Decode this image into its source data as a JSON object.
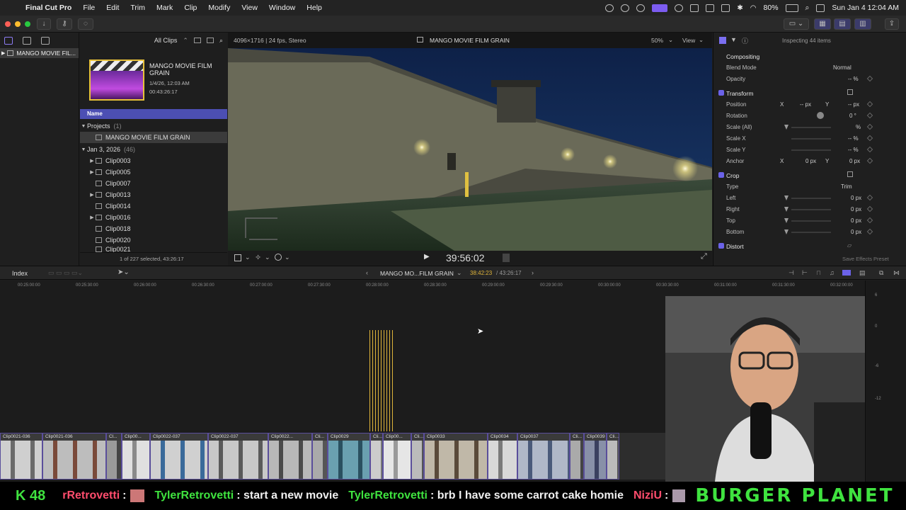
{
  "menubar": {
    "app_name": "Final Cut Pro",
    "menus": [
      "File",
      "Edit",
      "Trim",
      "Mark",
      "Clip",
      "Modify",
      "View",
      "Window",
      "Help"
    ],
    "battery": "80%",
    "datetime": "Sun Jan 4  12:04 AM"
  },
  "sidebar": {
    "library_label": "MANGO MOVIE FIL..."
  },
  "browser": {
    "filter": "All Clips",
    "project": {
      "title": "MANGO MOVIE FILM GRAIN",
      "date": "1/4/26, 12:03 AM",
      "duration": "00:43:26:17"
    },
    "column_header": "Name",
    "projects_label": "Projects",
    "projects_count": "(1)",
    "project_item": "MANGO MOVIE FILM GRAIN",
    "event_label": "Jan 3, 2026",
    "event_count": "(46)",
    "clips": [
      "Clip0003",
      "Clip0005",
      "Clip0007",
      "Clip0013",
      "Clip0014",
      "Clip0016",
      "Clip0018",
      "Clip0020",
      "Clip0021"
    ],
    "selection_status": "1 of 227 selected, 43:26:17"
  },
  "viewer": {
    "format": "4096×1716 | 24 fps, Stereo",
    "title": "MANGO MOVIE FILM GRAIN",
    "zoom": "50%",
    "view_label": "View",
    "timecode": "39:56:02"
  },
  "inspector": {
    "status": "Inspecting 44 items",
    "compositing": "Compositing",
    "blend_mode_label": "Blend Mode",
    "blend_mode_value": "Normal",
    "opacity_label": "Opacity",
    "opacity_value": "-- %",
    "transform": "Transform",
    "position_label": "Position",
    "position_x": "-- px",
    "position_y": "-- px",
    "rotation_label": "Rotation",
    "rotation_value": "0 °",
    "scale_all_label": "Scale (All)",
    "scale_all_value": "%",
    "scale_x_label": "Scale X",
    "scale_x_value": "-- %",
    "scale_y_label": "Scale Y",
    "scale_y_value": "-- %",
    "anchor_label": "Anchor",
    "anchor_x": "0 px",
    "anchor_y": "0 px",
    "crop": "Crop",
    "type_label": "Type",
    "type_value": "Trim",
    "left_label": "Left",
    "left_value": "0 px",
    "right_label": "Right",
    "right_value": "0 px",
    "top_label": "Top",
    "top_value": "0 px",
    "bottom_label": "Bottom",
    "bottom_value": "0 px",
    "distort": "Distort",
    "save_preset": "Save Effects Preset",
    "x_label": "X",
    "y_label": "Y"
  },
  "timeline": {
    "index_label": "Index",
    "project_label": "MANGO MO...FILM GRAIN",
    "position": "38:42:23",
    "total": "/ 43:26:17",
    "ruler": [
      "00:25:00:00",
      "00:25:30:00",
      "00:26:00:00",
      "00:26:30:00",
      "00:27:00:00",
      "00:27:30:00",
      "00:28:00:00",
      "00:28:30:00",
      "00:29:00:00",
      "00:29:30:00",
      "00:30:00:00",
      "00:30:30:00",
      "00:31:00:00",
      "00:31:30:00",
      "00:32:00:00"
    ],
    "meter_labels": [
      "6",
      "0",
      "-6",
      "-12"
    ],
    "clips": [
      "Clip0021-036",
      "Clip0021-036",
      "Cl...",
      "Clip00...",
      "Clip0022-037",
      "Clip0022-037",
      "Clip0022...",
      "Cli...",
      "Clip0029",
      "Cli...",
      "Clip00...",
      "Cli...",
      "Clip0033",
      "Clip0034",
      "Clip0037",
      "Cli...",
      "Clip0039",
      "Cli..."
    ]
  },
  "chat": {
    "badge": "K 48",
    "line1_user": "rRetrovetti",
    "line2_user": "TylerRetrovetti",
    "line2_msg": ": start a new movie",
    "line3_user": "TylerRetrovetti",
    "line3_msg": ": brb I have some carrot cake homie",
    "line4_user": "NiziU",
    "brand": "BURGER PLANET"
  },
  "colors": {
    "accent": "#6b62e8",
    "audio_waveform": "#e0b53a",
    "chat_user": "#3fe33f"
  }
}
